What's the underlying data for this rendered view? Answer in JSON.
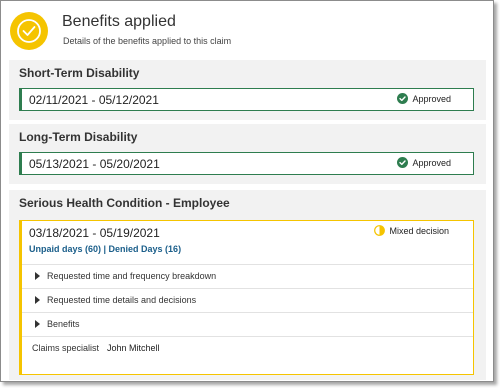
{
  "header": {
    "title": "Benefits applied",
    "subtitle": "Details of the benefits applied to this claim",
    "icon": "check-circle-icon",
    "accent_color": "#f5c400"
  },
  "sections": [
    {
      "title": "Short-Term Disability",
      "dates": "02/11/2021 - 05/12/2021",
      "status": "Approved",
      "status_icon": "check-circle-icon",
      "status_color": "#2e7d4f"
    },
    {
      "title": "Long-Term Disability",
      "dates": "05/13/2021 - 05/20/2021",
      "status": "Approved",
      "status_icon": "check-circle-icon",
      "status_color": "#2e7d4f"
    },
    {
      "title": "Serious Health Condition - Employee",
      "dates": "03/18/2021 - 05/19/2021",
      "days_summary": "Unpaid days (60) | Denied Days (16)",
      "status": "Mixed decision",
      "status_icon": "half-circle-icon",
      "status_color": "#f5c400",
      "accordions": [
        {
          "label": "Requested time and frequency breakdown"
        },
        {
          "label": "Requested time details and decisions"
        },
        {
          "label": "Benefits"
        }
      ],
      "claims_specialist_label": "Claims specialist",
      "claims_specialist_name": "John Mitchell"
    }
  ]
}
